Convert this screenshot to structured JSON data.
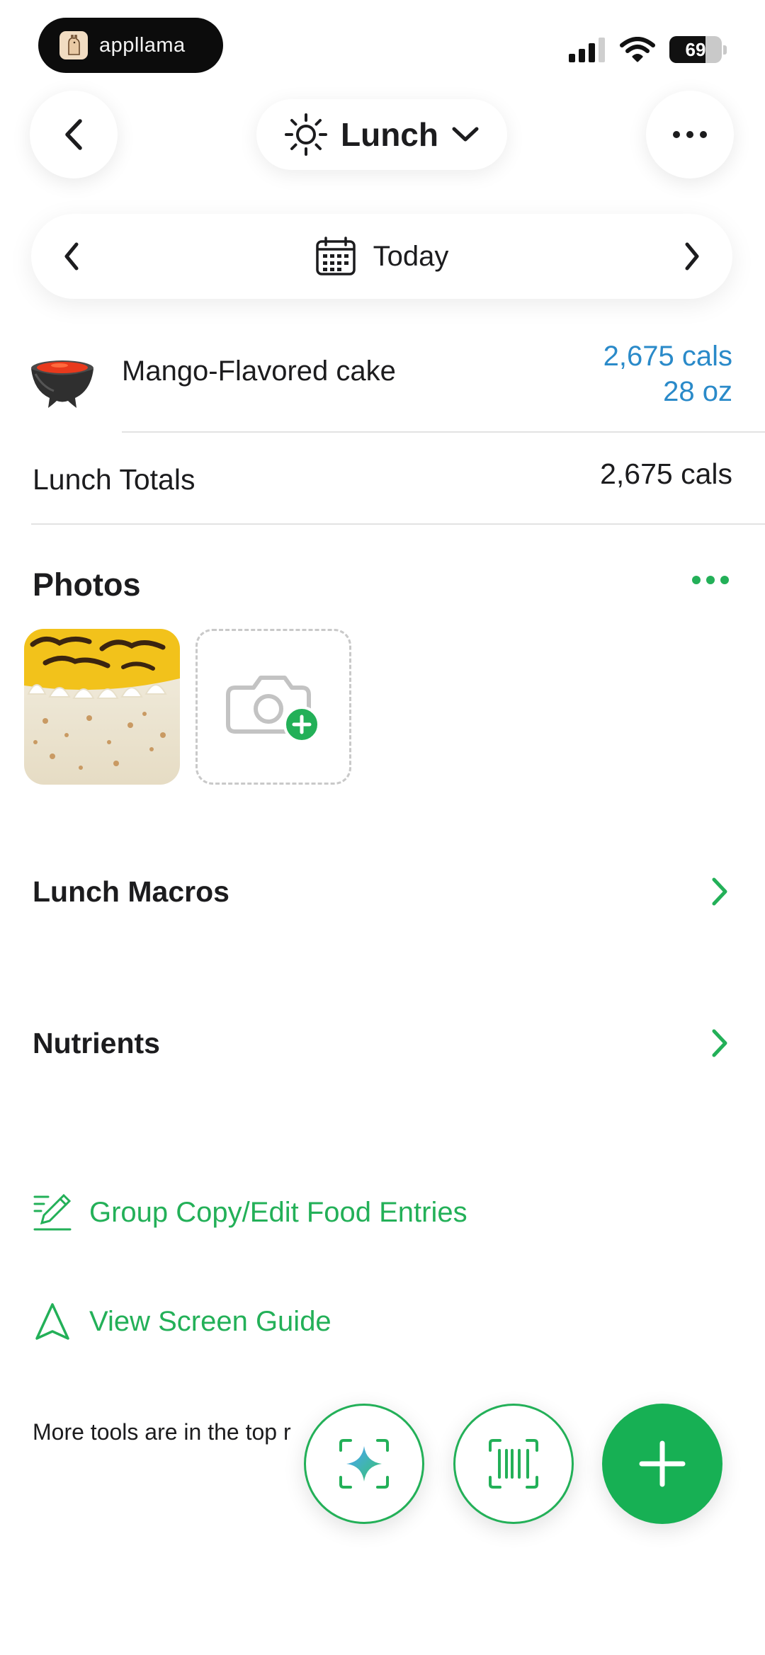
{
  "status_bar": {
    "app_name": "appllama",
    "battery_percent": "69",
    "battery_level": 0.69
  },
  "header": {
    "meal_label": "Lunch",
    "meal_icon": "sun-icon",
    "date_label": "Today"
  },
  "food_entry": {
    "name": "Mango-Flavored cake",
    "calories": "2,675 cals",
    "amount": "28 oz",
    "icon": "bowl-icon"
  },
  "totals": {
    "label": "Lunch Totals",
    "value": "2,675 cals"
  },
  "photos": {
    "title": "Photos",
    "add_icon": "add-photo-camera-icon"
  },
  "rows": {
    "macros": "Lunch Macros",
    "nutrients": "Nutrients"
  },
  "links": {
    "group_copy": "Group Copy/Edit Food Entries",
    "screen_guide": "View Screen Guide"
  },
  "footnote": "More tools are in the top r",
  "fabs": {
    "ai": "sparkle-scan-icon",
    "barcode": "barcode-scan-icon",
    "add": "plus-icon"
  },
  "colors": {
    "accent_green": "#23b058",
    "calorie_blue": "#2a8ac9",
    "fab_green": "#17b054"
  }
}
